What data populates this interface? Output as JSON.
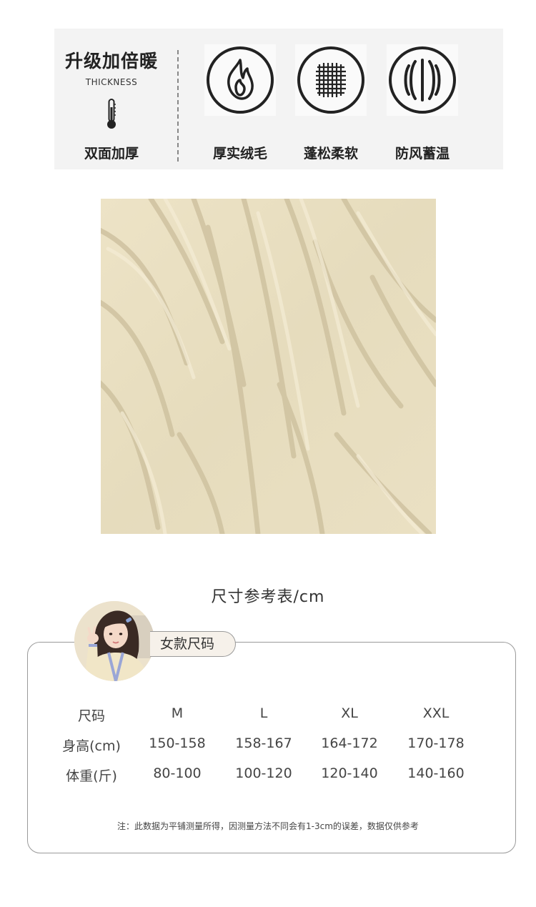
{
  "banner": {
    "title": "升级加倍暖",
    "subtitle": "THICKNESS",
    "left_label": "双面加厚",
    "features": [
      {
        "label": "厚实绒毛",
        "icon": "flame-icon"
      },
      {
        "label": "蓬松柔软",
        "icon": "fabric-weave-icon"
      },
      {
        "label": "防风蓄温",
        "icon": "wind-icon"
      }
    ]
  },
  "size_chart": {
    "title": "尺寸参考表/cm",
    "tag": "女款尺码",
    "header": [
      "尺码",
      "M",
      "L",
      "XL",
      "XXL"
    ],
    "rows": [
      [
        "身高(cm)",
        "150-158",
        "158-167",
        "164-172",
        "170-178"
      ],
      [
        "体重(斤)",
        "80-100",
        "100-120",
        "120-140",
        "140-160"
      ]
    ],
    "note": "注：此数据为平铺测量所得，因测量方法不同会有1-3cm的误差，数据仅供参考"
  }
}
